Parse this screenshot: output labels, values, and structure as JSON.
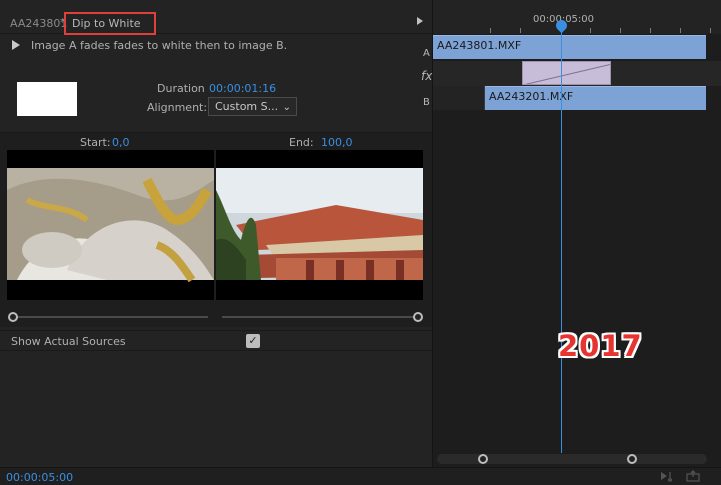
{
  "header": {
    "clip_name": "AA243801",
    "separator": "*",
    "effect_name": "Dip to White"
  },
  "description": "Image A fades fades to white then to image B.",
  "duration": {
    "label": "Duration",
    "value": "00:00:01:16"
  },
  "alignment": {
    "label": "Alignment:",
    "value": "Custom S..."
  },
  "start": {
    "label": "Start:",
    "value": "0,0"
  },
  "end": {
    "label": "End:",
    "value": "100,0"
  },
  "show_actual_sources": {
    "label": "Show Actual Sources",
    "checked": true
  },
  "timeline": {
    "timecode": "00:00:05:00",
    "tracks": {
      "a": {
        "label": "A",
        "clip": "AA243801.MXF"
      },
      "fx": {
        "label": "fx"
      },
      "b": {
        "label": "B",
        "clip": "AA243201.MXF"
      }
    },
    "playhead_color": "#3a8fe0",
    "clip_color": "#7da3d6",
    "transition_color": "#c7bdd9"
  },
  "watermark": "2017",
  "bottom_timecode": "00:00:05:00",
  "colors": {
    "accent": "#3a8fe0",
    "highlight_box": "#e0403a"
  }
}
